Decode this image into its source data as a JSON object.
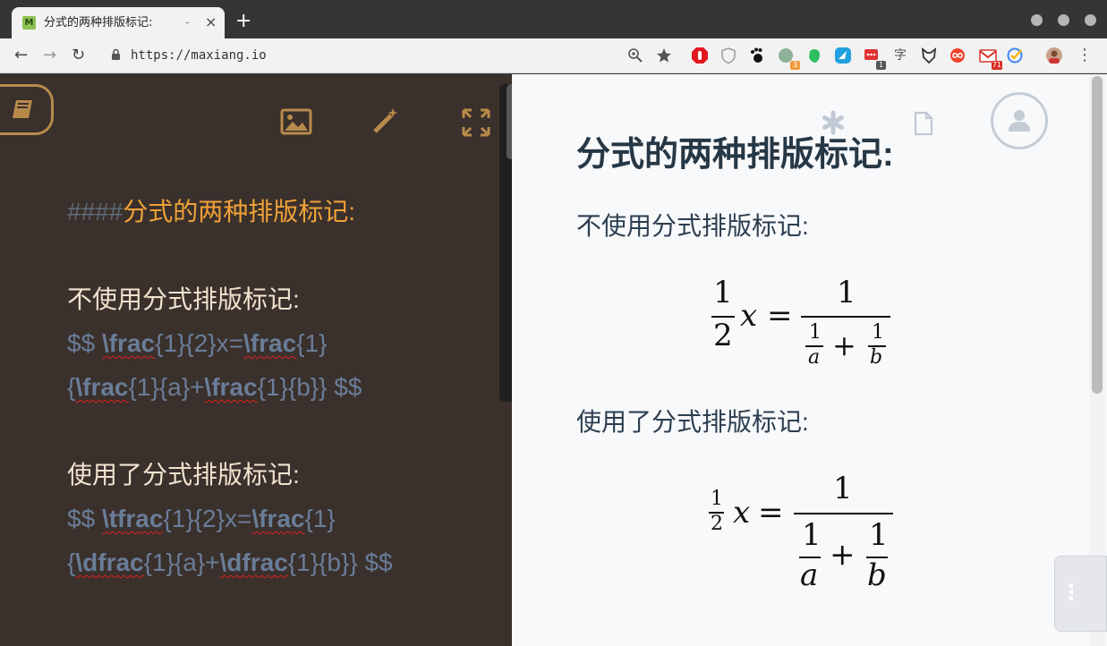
{
  "browser": {
    "tab": {
      "title": "分式的两种排版标记:",
      "dash": "-",
      "close": "×",
      "favicon_letter": "M"
    },
    "new_tab": "+",
    "url": "https://maxiang.io",
    "nav": {
      "back": "←",
      "forward": "→",
      "reload": "↻"
    },
    "extensions": {
      "translate_char": "字",
      "badge_a": "3",
      "badge_b": "1",
      "badge_c": "71"
    },
    "menu_icon": "⋮"
  },
  "editor": {
    "heading_hash": "####",
    "heading_text": "分式的两种排版标记:",
    "section1_label": "不使用分式排版标记:",
    "section1_line1": {
      "a": "$$ ",
      "cmd1": "\\frac",
      "b": "{1}{2}x=",
      "cmd2": "\\frac",
      "c": "{1}"
    },
    "section1_line2": {
      "a": "{",
      "cmd1": "\\frac",
      "b": "{1}{a}+",
      "cmd2": "\\frac",
      "c": "{1}{b}} $$"
    },
    "section2_label": "使用了分式排版标记:",
    "section2_line1": {
      "a": "$$ ",
      "cmd1": "\\tfrac",
      "b": "{1}{2}x=",
      "cmd2": "\\frac",
      "c": "{1}"
    },
    "section2_line2": {
      "a": "{",
      "cmd1": "\\dfrac",
      "b": "{1}{a}+",
      "cmd2": "\\dfrac",
      "c": "{1}{b}} $$"
    }
  },
  "preview": {
    "title": "分式的两种排版标记:",
    "section1_label": "不使用分式排版标记:",
    "section2_label": "使用了分式排版标记:",
    "formula1": {
      "n1": "1",
      "d1": "2",
      "x": "x",
      "eq": "=",
      "n2": "1",
      "a_num": "1",
      "a_den": "a",
      "plus": "+",
      "b_num": "1",
      "b_den": "b"
    },
    "formula2": {
      "n1": "1",
      "d1": "2",
      "x": "x",
      "eq": "=",
      "n2": "1",
      "a_num": "1",
      "a_den": "a",
      "plus": "+",
      "b_num": "1",
      "b_den": "b"
    },
    "handle_icon": "⋮"
  },
  "colors": {
    "editor_bg": "#3a302c",
    "accent": "#f0a238",
    "preview_bg": "#f8f9fb"
  }
}
